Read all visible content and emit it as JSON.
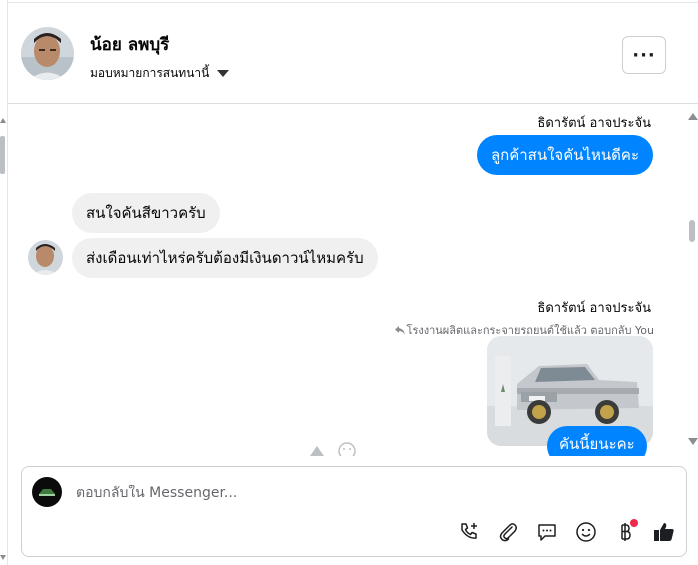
{
  "header": {
    "contact_name": "น้อย ลพบุรี",
    "assign_label": "มอบหมายการสนทนานี้",
    "more_label": "···"
  },
  "messages": {
    "sender_name_1": "ธิดารัตน์ อาจประจัน",
    "out_1": "ลูกค้าสนใจคันไหนดีคะ",
    "in_1": "สนใจคันสีขาวครับ",
    "in_2": "ส่งเดือนเท่าไหร่ครับต้องมีเงินดาวน์ไหมครับ",
    "sender_name_2": "ธิดารัตน์ อาจประจัน",
    "reply_context": "โรงงานผลิตและกระจายรถยนต์ใช้แล้ว ตอบกลับ You",
    "out_2_partial": "คันนี้ยนะคะ"
  },
  "composer": {
    "placeholder": "ตอบกลับใน Messenger..."
  },
  "icons": {
    "call": "phone-plus-icon",
    "attach": "paperclip-icon",
    "saved_reply": "chat-bubble-icon",
    "emoji": "smiley-icon",
    "currency": "baht-icon",
    "like": "thumbs-up-icon"
  },
  "colors": {
    "accent": "#0084ff",
    "incoming_bg": "#f0f0f0",
    "notification": "#f02849"
  }
}
